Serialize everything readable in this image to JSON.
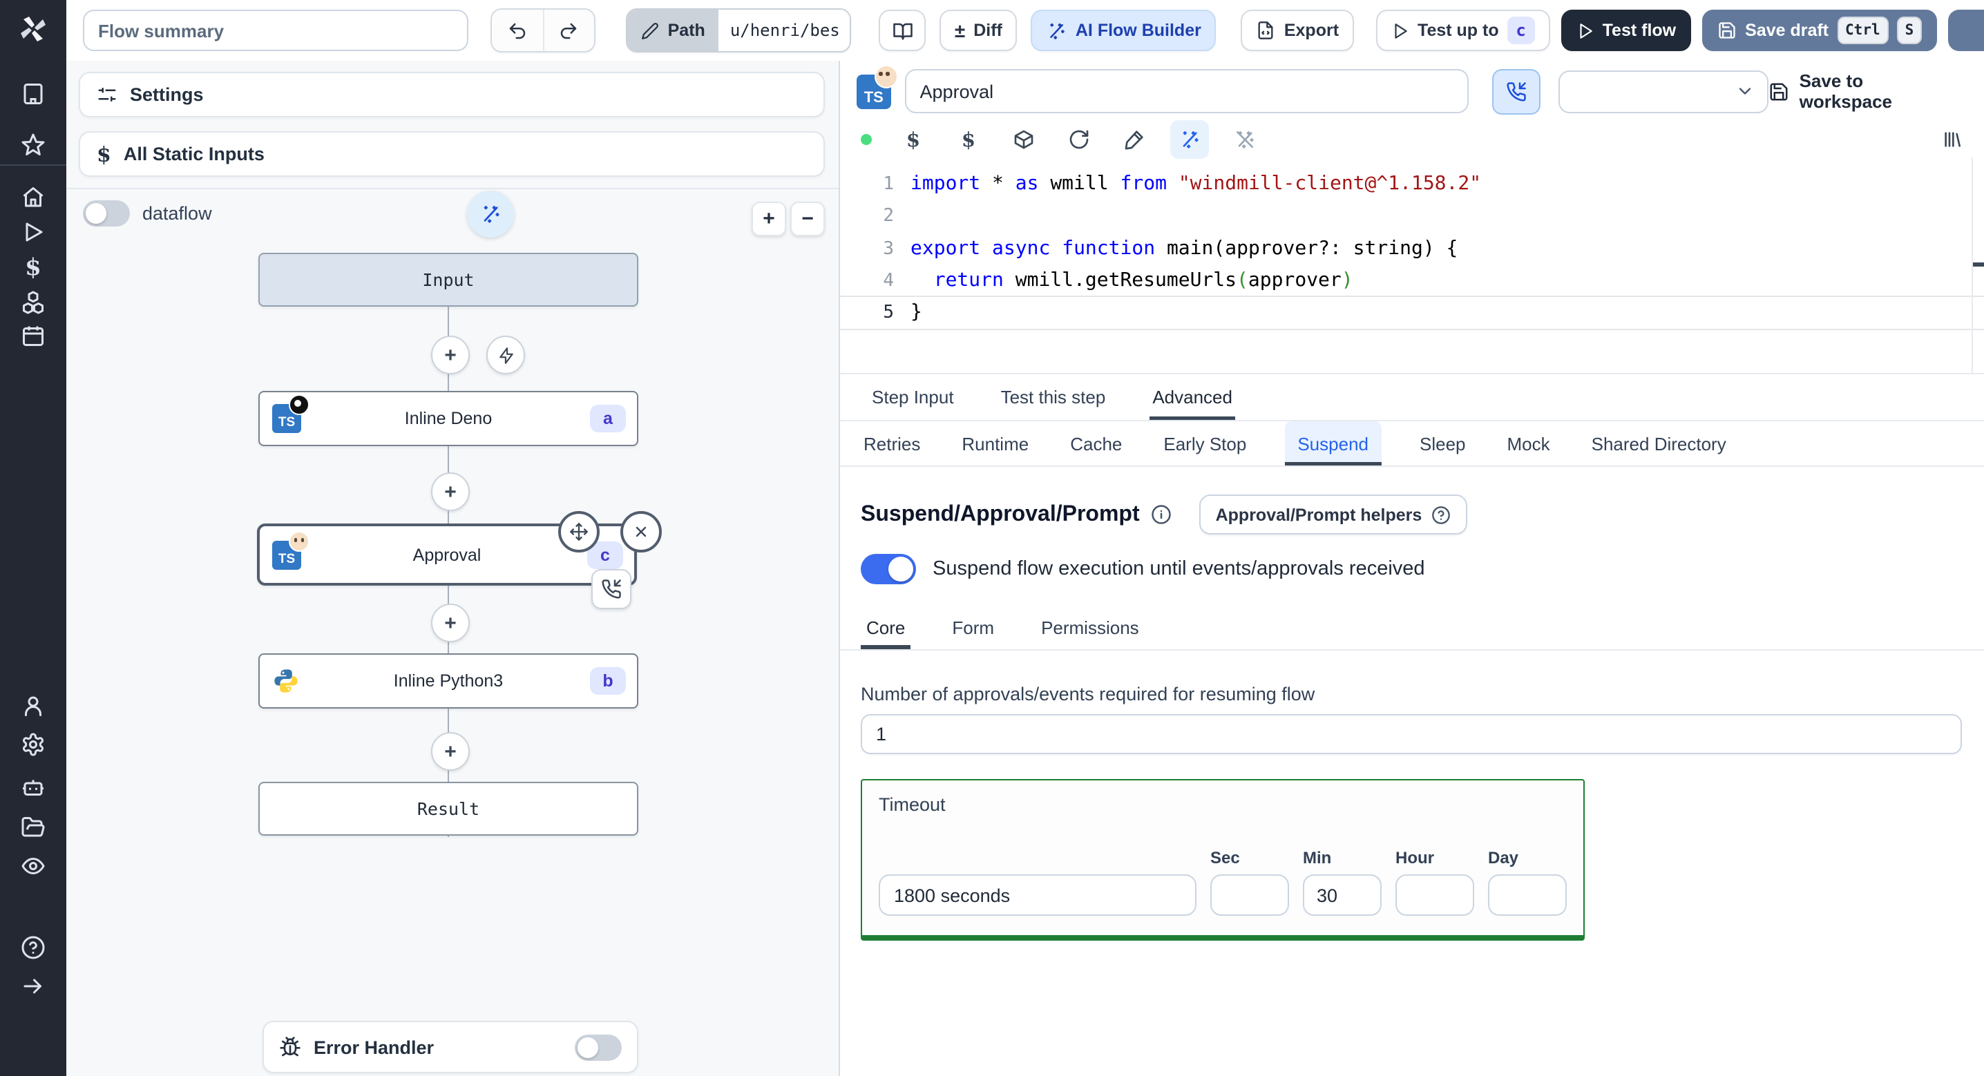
{
  "topbar": {
    "flow_summary_value": "Flow summary",
    "path_label": "Path",
    "path_value": "u/henri/bes",
    "diff_label": "Diff",
    "diff_glyph": "±",
    "ai_flow_builder_label": "AI Flow Builder",
    "export_label": "Export",
    "test_up_to_label": "Test up to",
    "test_up_to_badge": "c",
    "test_flow_label": "Test flow",
    "save_draft_label": "Save draft",
    "save_draft_kbd_1": "Ctrl",
    "save_draft_kbd_2": "S"
  },
  "sidebar": {
    "icons": [
      "windmill-logo",
      "building",
      "star",
      "home",
      "play",
      "dollar",
      "boxes",
      "calendar",
      "user",
      "settings",
      "bot",
      "folder-open",
      "eye",
      "help-circle",
      "arrow-right"
    ]
  },
  "left_panel": {
    "settings_label": "Settings",
    "static_inputs_label": "All Static Inputs",
    "dataflow_label": "dataflow",
    "zoom_in_glyph": "+",
    "zoom_out_glyph": "−",
    "plus_glyph": "+",
    "graph": {
      "input_label": "Input",
      "nodes": [
        {
          "title": "Inline Deno",
          "badge": "a",
          "lang": "deno-typescript"
        },
        {
          "title": "Approval",
          "badge": "c",
          "lang": "approval-typescript",
          "selected": true
        },
        {
          "title": "Inline Python3",
          "badge": "b",
          "lang": "python3"
        }
      ],
      "result_label": "Result"
    },
    "error_handler_label": "Error Handler"
  },
  "editor": {
    "step_name_value": "Approval",
    "save_to_workspace_label": "Save to workspace",
    "toolbar_icons": [
      "status-dot",
      "dollar-static",
      "dollar-dynamic",
      "package",
      "refresh",
      "format-brush",
      "ai-wand",
      "ai-wand-off",
      "library"
    ],
    "code": {
      "lines": [
        [
          {
            "t": "import",
            "c": "kw"
          },
          {
            "t": " * ",
            "c": "pl"
          },
          {
            "t": "as",
            "c": "kw"
          },
          {
            "t": " wmill ",
            "c": "pl"
          },
          {
            "t": "from",
            "c": "kw"
          },
          {
            "t": " ",
            "c": "pl"
          },
          {
            "t": "\"windmill-client@^1.158.2\"",
            "c": "str"
          }
        ],
        [],
        [
          {
            "t": "export",
            "c": "kw"
          },
          {
            "t": " ",
            "c": "pl"
          },
          {
            "t": "async",
            "c": "kw"
          },
          {
            "t": " ",
            "c": "pl"
          },
          {
            "t": "function",
            "c": "kw"
          },
          {
            "t": " main(approver?: string) {",
            "c": "pl"
          }
        ],
        [
          {
            "t": "  ",
            "c": "pl"
          },
          {
            "t": "return",
            "c": "kw"
          },
          {
            "t": " wmill.getResumeUrls",
            "c": "pl"
          },
          {
            "t": "(",
            "c": "brk"
          },
          {
            "t": "approver",
            "c": "pl"
          },
          {
            "t": ")",
            "c": "brk"
          }
        ],
        [
          {
            "t": "}",
            "c": "pl"
          }
        ]
      ],
      "active_line": 5
    },
    "tabs": {
      "items": [
        "Step Input",
        "Test this step",
        "Advanced"
      ],
      "active": 2
    },
    "advanced_tabs": {
      "items": [
        "Retries",
        "Runtime",
        "Cache",
        "Early Stop",
        "Suspend",
        "Sleep",
        "Mock",
        "Shared Directory"
      ],
      "active": 4
    }
  },
  "suspend": {
    "heading": "Suspend/Approval/Prompt",
    "helpers_label": "Approval/Prompt helpers",
    "toggle_label": "Suspend flow execution until events/approvals received",
    "toggle_on": true,
    "tabs": {
      "items": [
        "Core",
        "Form",
        "Permissions"
      ],
      "active": 0
    },
    "approvals_label": "Number of approvals/events required for resuming flow",
    "approvals_value": "1",
    "timeout": {
      "label": "Timeout",
      "value": "1800 seconds",
      "units": [
        "Sec",
        "Min",
        "Hour",
        "Day"
      ],
      "filled_unit": "Min",
      "filled_value": "30"
    }
  },
  "colors": {
    "sidebar_bg": "#232833",
    "accent_blue": "#3b6cf0",
    "ai_button_bg": "#dbeafe",
    "ai_button_ink": "#1e40af",
    "save_draft_bg": "#63799b",
    "test_flow_bg": "#1f2937",
    "badge_bg": "#e0e7ff",
    "badge_ink": "#4338ca",
    "typescript_blue": "#3178c6",
    "timeout_border_green": "#1e7e34",
    "suspend_tab_ink": "#2563eb",
    "code_keyword": "#0000ff",
    "code_string": "#a31515",
    "status_dot_green": "#4ade80"
  }
}
